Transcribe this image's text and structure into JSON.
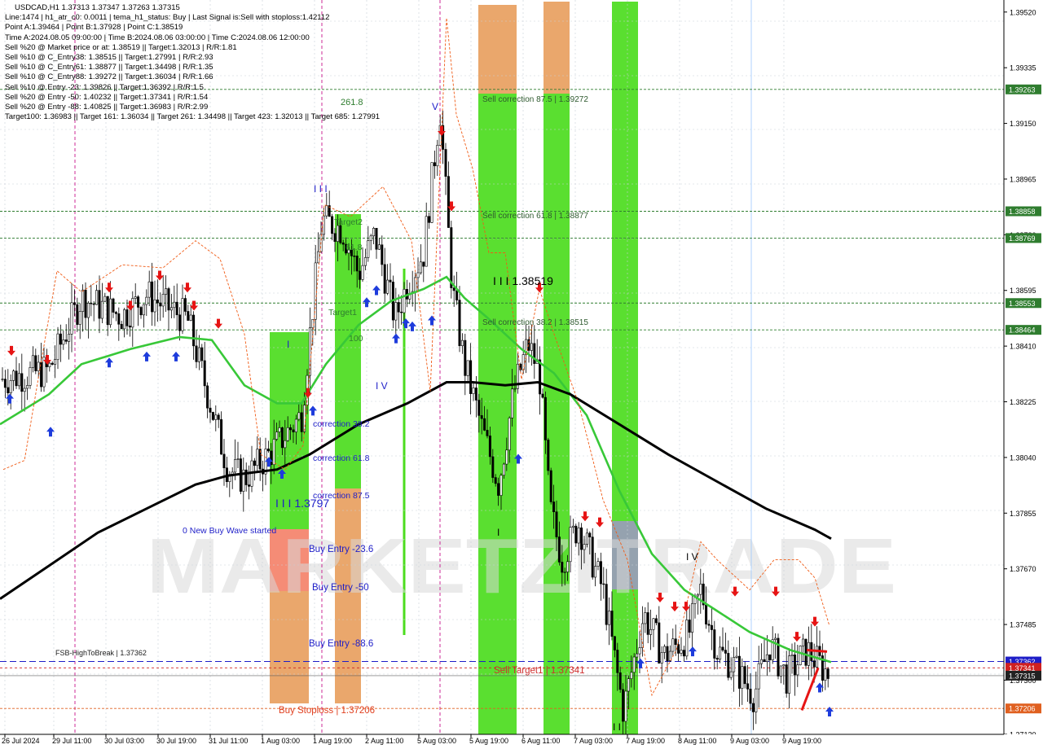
{
  "header_lines": [
    "USDCAD,H1  1.37313 1.37347 1.37263 1.37315",
    "Line:1474 | h1_atr_c0: 0.0011 | tema_h1_status: Buy | Last Signal is:Sell with stoploss:1.42112",
    "Point A:1.39464 | Point B:1.37928 | Point C:1.38519",
    "Time A:2024.08.05 09:00:00 | Time B:2024.08.06 03:00:00 | Time C:2024.08.06 12:00:00",
    "Sell %20 @ Market price or at: 1.38519 || Target:1.32013 | R/R:1.81",
    "Sell %10 @ C_Entry38: 1.38515 || Target:1.27991 | R/R:2.93",
    "Sell %10 @ C_Entry61: 1.38877 || Target:1.34498 | R/R:1.35",
    "Sell %10 @ C_Entry88: 1.39272 || Target:1.36034 | R/R:1.66",
    "Sell %10 @ Entry -23: 1.39826 || Target:1.36392 | R/R:1.5",
    "Sell %20 @ Entry -50: 1.40232 || Target:1.37341 | R/R:1.54",
    "Sell %20 @ Entry -88: 1.40825 || Target:1.36983 | R/R:2.99",
    "Target100: 1.36983 || Target 161: 1.36034 || Target 261: 1.34498 || Target 423: 1.32013 || Target 685: 1.27991"
  ],
  "watermark": "MARKETZITRADE",
  "colors": {
    "green_zone": "#4cdc1e",
    "orange_zone": "#e8a060",
    "salmon_zone": "#f4826a",
    "grey_zone": "#8c9aa8",
    "ma_fast": "#38c838",
    "ma_slow": "#000000",
    "envelope": "#f05a14",
    "arrow_up": "#1e3cdc",
    "arrow_down": "#e61414",
    "price_level": "#2f7d2f",
    "blue_level": "#1e1ec8",
    "orange_level": "#e06020"
  },
  "chart_data": {
    "type": "candlestick",
    "symbol": "USDCAD",
    "timeframe": "H1",
    "ylim": [
      1.3712,
      1.3956
    ],
    "y_ticks": [
      "1.39520",
      "1.39335",
      "1.39150",
      "1.38965",
      "1.38780",
      "1.38595",
      "1.38410",
      "1.38225",
      "1.38040",
      "1.37855",
      "1.37670",
      "1.37485",
      "1.37300",
      "1.37120"
    ],
    "x_ticks": [
      "26 Jul 2024",
      "29 Jul 11:00",
      "30 Jul 03:00",
      "30 Jul 19:00",
      "31 Jul 11:00",
      "1 Aug 03:00",
      "1 Aug 19:00",
      "2 Aug 11:00",
      "5 Aug 03:00",
      "5 Aug 19:00",
      "6 Aug 11:00",
      "7 Aug 03:00",
      "7 Aug 19:00",
      "8 Aug 11:00",
      "9 Aug 03:00",
      "9 Aug 19:00"
    ],
    "price_labels": [
      {
        "text": "1.39263",
        "value": 1.39263,
        "bg": "#2f7d2f"
      },
      {
        "text": "1.38858",
        "value": 1.38858,
        "bg": "#2f7d2f"
      },
      {
        "text": "1.38769",
        "value": 1.38769,
        "bg": "#2f7d2f"
      },
      {
        "text": "1.38553",
        "value": 1.38553,
        "bg": "#2f7d2f"
      },
      {
        "text": "1.38464",
        "value": 1.38464,
        "bg": "#2f7d2f"
      },
      {
        "text": "1.37362",
        "value": 1.37362,
        "bg": "#1e1ec8"
      },
      {
        "text": "1.37341",
        "value": 1.37341,
        "bg": "#d02020"
      },
      {
        "text": "1.37315",
        "value": 1.37315,
        "bg": "#222222"
      },
      {
        "text": "1.37206",
        "value": 1.37206,
        "bg": "#e06020"
      }
    ],
    "annotations": [
      {
        "text": "Sell correction 87.5 | 1.39272"
      },
      {
        "text": "Sell correction 61.8 | 1.38877"
      },
      {
        "text": "Sell correction 38.2 | 1.38515"
      },
      {
        "text": "I I I 1.38519"
      },
      {
        "text": "261.8"
      },
      {
        "text": "Target2"
      },
      {
        "text": "61.8"
      },
      {
        "text": "Target1"
      },
      {
        "text": "100"
      },
      {
        "text": "I I I"
      },
      {
        "text": "I V"
      },
      {
        "text": "V"
      },
      {
        "text": "I"
      },
      {
        "text": "correction 38.2"
      },
      {
        "text": "correction 61.8"
      },
      {
        "text": "correction 87.5"
      },
      {
        "text": "I I I 1.3797"
      },
      {
        "text": "0 New Buy Wave started"
      },
      {
        "text": "Buy Entry -23.6"
      },
      {
        "text": "Buy Entry -50"
      },
      {
        "text": "Buy Entry -88.6"
      },
      {
        "text": "FSB-HighToBreak | 1.37362"
      },
      {
        "text": "Sell Target1 | 1.37341"
      },
      {
        "text": "Buy Stoploss | 1.37206"
      },
      {
        "text": "I V"
      },
      {
        "text": "I"
      },
      {
        "text": "I I"
      }
    ],
    "series": [
      {
        "name": "",
        "style": "candles"
      },
      {
        "name": "",
        "style": "fast-ma"
      },
      {
        "name": "",
        "style": "slow-ma"
      }
    ]
  }
}
